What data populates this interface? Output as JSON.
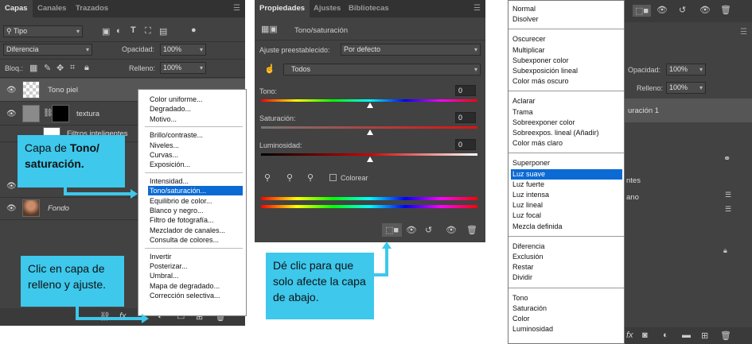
{
  "layers_panel": {
    "tabs": [
      "Capas",
      "Canales",
      "Trazados"
    ],
    "filter_kind": "Tipo",
    "blend_mode": "Diferencia",
    "opacity_label": "Opacidad:",
    "opacity_value": "100%",
    "lock_label": "Bloq.:",
    "fill_label": "Relleno:",
    "fill_value": "100%",
    "layers": [
      {
        "name": "Tono piel"
      },
      {
        "name": "textura"
      },
      {
        "name": "Filtros inteligentes"
      },
      {
        "name": "Fondo"
      }
    ]
  },
  "adjust_menu": {
    "items_1": [
      "Color uniforme...",
      "Degradado...",
      "Motivo..."
    ],
    "items_2": [
      "Brillo/contraste...",
      "Niveles...",
      "Curvas...",
      "Exposición..."
    ],
    "items_3": [
      "Intensidad...",
      "Tono/saturación...",
      "Equilibrio de color...",
      "Blanco y negro...",
      "Filtro de fotografía...",
      "Mezclador de canales...",
      "Consulta de colores..."
    ],
    "items_4": [
      "Invertir",
      "Posterizar...",
      "Umbral...",
      "Mapa de degradado...",
      "Corrección selectiva..."
    ],
    "highlighted": "Tono/saturación..."
  },
  "callouts": {
    "tono_prefix": "Capa de ",
    "tono_bold": "Tono/ saturación.",
    "clic": "Clic en capa de relleno y ajuste.",
    "de_clic": "Dé clic para que solo afecte la capa de abajo."
  },
  "properties_panel": {
    "tabs": [
      "Propiedades",
      "Ajustes",
      "Bibliotecas"
    ],
    "title": "Tono/saturación",
    "preset_label": "Ajuste preestablecido:",
    "preset_value": "Por defecto",
    "channel": "Todos",
    "hue_label": "Tono:",
    "hue_value": "0",
    "sat_label": "Saturación:",
    "sat_value": "0",
    "light_label": "Luminosidad:",
    "light_value": "0",
    "colorize_label": "Colorear",
    "colors": {
      "accent": "#3dc8ec",
      "highlight": "#0b6ad4"
    }
  },
  "blend_menu": {
    "groups": [
      [
        "Normal",
        "Disolver"
      ],
      [
        "Oscurecer",
        "Multiplicar",
        "Subexponer color",
        "Subexposición lineal",
        "Color más oscuro"
      ],
      [
        "Aclarar",
        "Trama",
        "Sobreexponer color",
        "Sobreexpos. lineal (Añadir)",
        "Color más claro"
      ],
      [
        "Superponer",
        "Luz suave",
        "Luz fuerte",
        "Luz intensa",
        "Luz lineal",
        "Luz focal",
        "Mezcla definida"
      ],
      [
        "Diferencia",
        "Exclusión",
        "Restar",
        "Dividir"
      ],
      [
        "Tono",
        "Saturación",
        "Color",
        "Luminosidad"
      ]
    ],
    "highlighted": "Luz suave"
  },
  "right_panel": {
    "opacity_label": "Opacidad:",
    "opacity_value": "100%",
    "fill_label": "Relleno:",
    "fill_value": "100%",
    "layer_partial_1": "uración 1",
    "layer_partial_2": "ntes",
    "layer_partial_3": "ano"
  }
}
